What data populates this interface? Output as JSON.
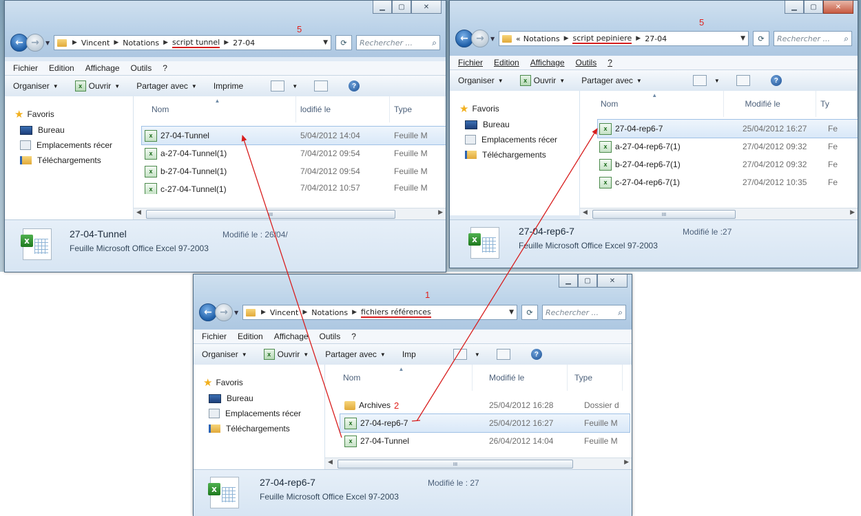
{
  "windows": {
    "tunnel": {
      "breadcrumb": [
        "Vincent",
        "Notations",
        "script tunnel",
        "27-04"
      ],
      "search_placeholder": "Rechercher ...",
      "menu": [
        "Fichier",
        "Edition",
        "Affichage",
        "Outils",
        "?"
      ],
      "toolbar": {
        "organize": "Organiser",
        "open": "Ouvrir",
        "share": "Partager avec",
        "print": "Imprime"
      },
      "nav": {
        "favorites": "Favoris",
        "desktop": "Bureau",
        "recent": "Emplacements récer",
        "downloads": "Téléchargements"
      },
      "columns": {
        "name": "Nom",
        "modified": "lodifié le",
        "type": "Type"
      },
      "files": [
        {
          "name": "27-04-Tunnel",
          "modified": "5/04/2012 14:04",
          "type": "Feuille M"
        },
        {
          "name": "a-27-04-Tunnel(1)",
          "modified": "7/04/2012 09:54",
          "type": "Feuille M"
        },
        {
          "name": "b-27-04-Tunnel(1)",
          "modified": "7/04/2012 09:54",
          "type": "Feuille M"
        },
        {
          "name": "c-27-04-Tunnel(1)",
          "modified": "7/04/2012 10:57",
          "type": "Feuille M"
        }
      ],
      "details": {
        "name": "27-04-Tunnel",
        "type": "Feuille Microsoft Office Excel 97-2003",
        "modified": "Modifié le : 26/04/"
      },
      "scroll_label": "III",
      "annotation": "5"
    },
    "pepiniere": {
      "breadcrumb_prefix": "«",
      "breadcrumb": [
        "Notations",
        "script pepiniere",
        "27-04"
      ],
      "search_placeholder": "Rechercher ...",
      "menu": [
        "Fichier",
        "Edition",
        "Affichage",
        "Outils",
        "?"
      ],
      "toolbar": {
        "organize": "Organiser",
        "open": "Ouvrir",
        "share": "Partager avec"
      },
      "nav": {
        "favorites": "Favoris",
        "desktop": "Bureau",
        "recent": "Emplacements récer",
        "downloads": "Téléchargements"
      },
      "columns": {
        "name": "Nom",
        "modified": "Modifié le",
        "type": "Ty"
      },
      "files": [
        {
          "name": "27-04-rep6-7",
          "modified": "25/04/2012 16:27",
          "type": "Fe"
        },
        {
          "name": "a-27-04-rep6-7(1)",
          "modified": "27/04/2012 09:32",
          "type": "Fe"
        },
        {
          "name": "b-27-04-rep6-7(1)",
          "modified": "27/04/2012 09:32",
          "type": "Fe"
        },
        {
          "name": "c-27-04-rep6-7(1)",
          "modified": "27/04/2012 10:35",
          "type": "Fe"
        }
      ],
      "details": {
        "name": "27-04-rep6-7",
        "type": "Feuille Microsoft Office Excel 97-2003",
        "modified": "Modifié le :27"
      },
      "scroll_label": "III",
      "annotation": "5"
    },
    "references": {
      "breadcrumb": [
        "Vincent",
        "Notations",
        "fichiers références"
      ],
      "search_placeholder": "Rechercher ...",
      "menu": [
        "Fichier",
        "Edition",
        "Affichage",
        "Outils",
        "?"
      ],
      "toolbar": {
        "organize": "Organiser",
        "open": "Ouvrir",
        "share": "Partager avec",
        "print": "Imp"
      },
      "nav": {
        "favorites": "Favoris",
        "desktop": "Bureau",
        "recent": "Emplacements récer",
        "downloads": "Téléchargements"
      },
      "columns": {
        "name": "Nom",
        "modified": "Modifié le",
        "type": "Type"
      },
      "files": [
        {
          "name": "Archives",
          "modified": "25/04/2012 16:28",
          "type": "Dossier d"
        },
        {
          "name": "27-04-rep6-7",
          "modified": "25/04/2012 16:27",
          "type": "Feuille M"
        },
        {
          "name": "27-04-Tunnel",
          "modified": "26/04/2012 14:04",
          "type": "Feuille M"
        }
      ],
      "details": {
        "name": "27-04-rep6-7",
        "type": "Feuille Microsoft Office Excel 97-2003",
        "modified": "Modifié le : 27"
      },
      "scroll_label": "III",
      "annotation": "1",
      "archives_annotation": "2"
    }
  },
  "colors": {
    "annotation_red": "#d81e1e",
    "selection": "#d9e8f8",
    "frame": "#b9d1e8"
  }
}
